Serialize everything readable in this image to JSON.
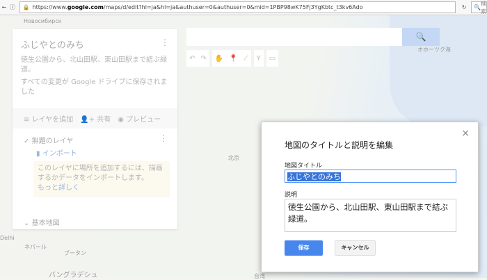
{
  "browser": {
    "url_prefix": "https://www.",
    "url_domain": "google.com",
    "url_rest": "/maps/d/edit?hl=ja&hl=ja&authuser=0&authuser=0&mid=1PBP98wK75Fj3YgKbtc_t3kv6Ado",
    "search_placeholder": "検索"
  },
  "map_labels": {
    "novosibirsk": "Новосибирск",
    "beijing": "北京",
    "nepal": "ネパール",
    "bhutan": "ブータン",
    "bangladesh": "バングラデシュ",
    "taiwan": "台湾",
    "okhotsk": "オホーツク海",
    "delhi": "Delhi"
  },
  "panel": {
    "title": "ふじやとのみち",
    "description": "徳生公園から、北山田駅、東山田駅まで結ぶ緑道。",
    "saved_status": "すべての変更が Google ドライブに保存されました",
    "add_layer": "レイヤを追加",
    "share": "共有",
    "preview": "プレビュー",
    "layer_name": "無題のレイヤ",
    "import": "インポート",
    "tip": "このレイヤに場所を追加するには、描画するかデータをインポートします。",
    "learn_more": "もっと詳しく",
    "base_map": "基本地図"
  },
  "dialog": {
    "title": "地図のタイトルと説明を編集",
    "title_label": "地図タイトル",
    "title_value": "ふじやとのみち",
    "desc_label": "説明",
    "desc_value": "徳生公園から、北山田駅、東山田駅まで結ぶ緑道。",
    "save": "保存",
    "cancel": "キャンセル",
    "close": "×"
  }
}
